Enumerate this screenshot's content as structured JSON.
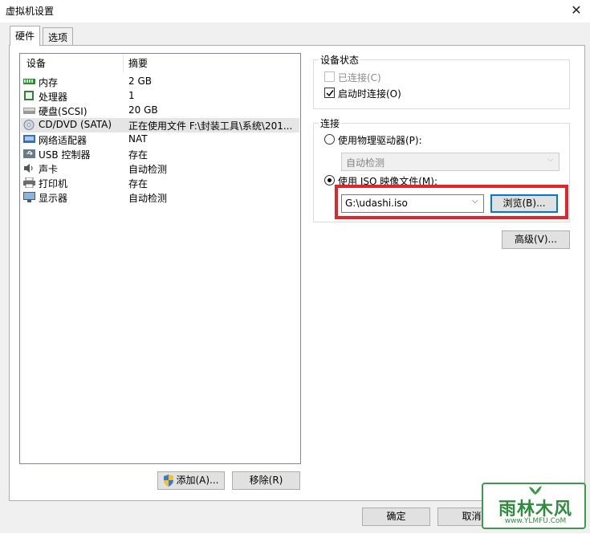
{
  "window": {
    "title": "虚拟机设置"
  },
  "tabs": [
    {
      "label": "硬件"
    },
    {
      "label": "选项"
    }
  ],
  "device_list": {
    "headers": {
      "device": "设备",
      "summary": "摘要"
    },
    "rows": [
      {
        "name": "内存",
        "summary": "2 GB",
        "icon": "memory-icon"
      },
      {
        "name": "处理器",
        "summary": "1",
        "icon": "processor-icon"
      },
      {
        "name": "硬盘(SCSI)",
        "summary": "20 GB",
        "icon": "hard-disk-icon"
      },
      {
        "name": "CD/DVD (SATA)",
        "summary": "正在使用文件 F:\\封装工具\\系统\\201...",
        "icon": "cd-dvd-icon",
        "selected": true
      },
      {
        "name": "网络适配器",
        "summary": "NAT",
        "icon": "network-adapter-icon"
      },
      {
        "name": "USB 控制器",
        "summary": "存在",
        "icon": "usb-icon"
      },
      {
        "name": "声卡",
        "summary": "自动检测",
        "icon": "sound-card-icon"
      },
      {
        "name": "打印机",
        "summary": "存在",
        "icon": "printer-icon"
      },
      {
        "name": "显示器",
        "summary": "自动检测",
        "icon": "display-icon"
      }
    ]
  },
  "list_buttons": {
    "add": "添加(A)...",
    "remove": "移除(R)"
  },
  "device_status": {
    "legend": "设备状态",
    "connected": {
      "label": "已连接(C)",
      "checked": false,
      "disabled": true
    },
    "connect_at_power_on": {
      "label": "启动时连接(O)",
      "checked": true
    }
  },
  "connection": {
    "legend": "连接",
    "physical_drive": {
      "label": "使用物理驱动器(P):",
      "selected": false
    },
    "physical_drive_select": {
      "value": "自动检测",
      "disabled": true
    },
    "iso_image": {
      "label": "使用 ISO 映像文件(M):",
      "selected": true
    },
    "iso_path": {
      "value": "G:\\udashi.iso"
    },
    "browse_button": "浏览(B)...",
    "advanced_button": "高级(V)..."
  },
  "footer": {
    "ok": "确定",
    "cancel": "取消"
  },
  "watermark": {
    "brand": "雨林木风",
    "url": "www.YLMFU.CoM"
  },
  "colors": {
    "highlight": "#e0262b",
    "focus": "#0078d7",
    "selected_row": "#e5e5e5"
  }
}
